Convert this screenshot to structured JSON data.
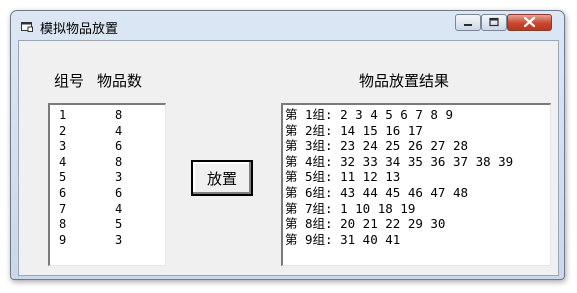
{
  "window": {
    "title": "模拟物品放置"
  },
  "left_panel": {
    "header_group": "组号",
    "header_count": "物品数",
    "rows": [
      [
        "1",
        "8"
      ],
      [
        "2",
        "4"
      ],
      [
        "3",
        "6"
      ],
      [
        "4",
        "8"
      ],
      [
        "5",
        "3"
      ],
      [
        "6",
        "6"
      ],
      [
        "7",
        "4"
      ],
      [
        "8",
        "5"
      ],
      [
        "9",
        "3"
      ]
    ]
  },
  "place_button": {
    "label": "放置"
  },
  "right_panel": {
    "header": "物品放置结果",
    "rows": [
      "第 1组: 2 3 4 5 6 7 8 9",
      "第 2组: 14 15 16 17",
      "第 3组: 23 24 25 26 27 28",
      "第 4组: 32 33 34 35 36 37 38 39",
      "第 5组: 11 12 13",
      "第 6组: 43 44 45 46 47 48",
      "第 7组: 1 10 18 19",
      "第 8组: 20 21 22 29 30",
      "第 9组: 31 40 41"
    ]
  },
  "icons": {
    "app": "app-icon",
    "minimize": "minimize-icon",
    "maximize": "maximize-icon",
    "close": "close-icon"
  }
}
